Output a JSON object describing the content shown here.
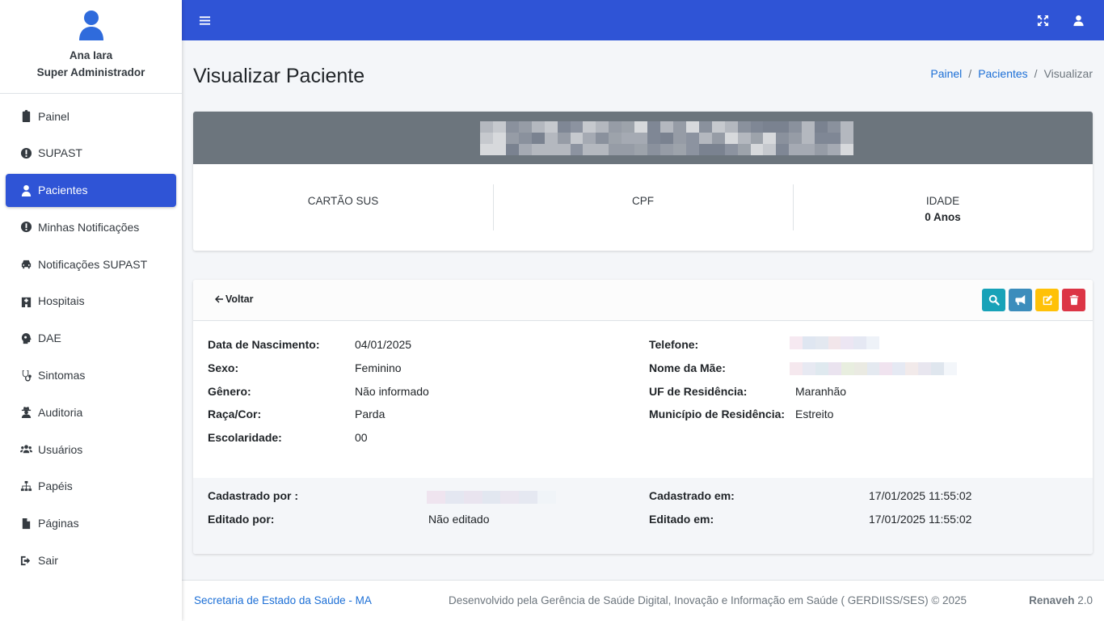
{
  "user": {
    "name": "Ana Iara",
    "role": "Super Administrador"
  },
  "sidebar": {
    "items": [
      {
        "label": "Painel",
        "icon": "clipboard-icon"
      },
      {
        "label": "SUPAST",
        "icon": "exclamation-circle-icon"
      },
      {
        "label": "Pacientes",
        "icon": "user-injured-icon",
        "active": true
      },
      {
        "label": "Minhas Notificações",
        "icon": "exclamation-circle-icon"
      },
      {
        "label": "Notificações SUPAST",
        "icon": "car-icon"
      },
      {
        "label": "Hospitais",
        "icon": "hospital-icon"
      },
      {
        "label": "DAE",
        "icon": "head-virus-icon"
      },
      {
        "label": "Sintomas",
        "icon": "stethoscope-icon"
      },
      {
        "label": "Auditoria",
        "icon": "user-secret-icon"
      },
      {
        "label": "Usuários",
        "icon": "users-icon"
      },
      {
        "label": "Papéis",
        "icon": "sitemap-icon"
      },
      {
        "label": "Páginas",
        "icon": "file-icon"
      },
      {
        "label": "Sair",
        "icon": "sign-out-icon"
      }
    ]
  },
  "page": {
    "title": "Visualizar Paciente",
    "breadcrumb": [
      "Painel",
      "Pacientes",
      "Visualizar"
    ]
  },
  "summary": {
    "stats": [
      {
        "label": "CARTÃO SUS",
        "value": ""
      },
      {
        "label": "CPF",
        "value": ""
      },
      {
        "label": "IDADE",
        "value": "0 Anos"
      }
    ]
  },
  "details": {
    "back_label": "Voltar",
    "left": [
      {
        "label": "Data de Nascimento:",
        "value": "04/01/2025"
      },
      {
        "label": "Sexo:",
        "value": "Feminino"
      },
      {
        "label": "Gênero:",
        "value": "Não informado"
      },
      {
        "label": "Raça/Cor:",
        "value": "Parda"
      },
      {
        "label": "Escolaridade:",
        "value": "00"
      }
    ],
    "right": [
      {
        "label": "Telefone:",
        "value": ""
      },
      {
        "label": "Nome da Mãe:",
        "value": ""
      },
      {
        "label": "UF de Residência:",
        "value": "Maranhão"
      },
      {
        "label": "Município de Residência:",
        "value": "Estreito"
      }
    ]
  },
  "audit": {
    "created_by_label": "Cadastrado por :",
    "edited_by_label": "Editado por:",
    "edited_by_value": "Não editado",
    "created_at_label": "Cadastrado em:",
    "created_at_value": "17/01/2025 11:55:02",
    "edited_at_label": "Editado em:",
    "edited_at_value": "17/01/2025 11:55:02"
  },
  "footer": {
    "left": "Secretaria de Estado da Saúde - MA",
    "middle": "Desenvolvido pela Gerência de Saúde Digital, Inovação e Informação em Saúde ( GERDIISS/SES) © 2025",
    "brand": "Renaveh",
    "version": "2.0"
  },
  "colors": {
    "primary": "#2f54d6",
    "header_gray": "#6c757d",
    "btn_info": "#17a2b8",
    "btn_primary": "#3c8dbc",
    "btn_warning": "#ffc107",
    "btn_danger": "#dc3545"
  }
}
